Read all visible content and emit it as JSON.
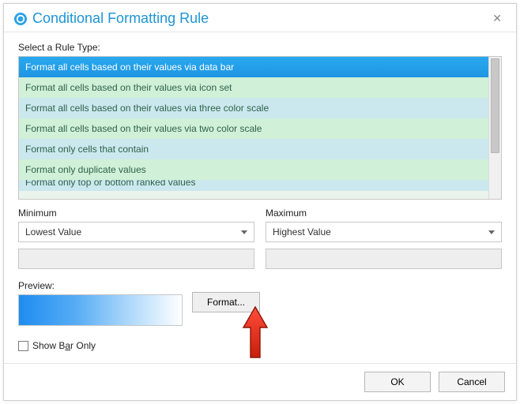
{
  "dialog": {
    "title": "Conditional Formatting Rule",
    "rule_type_label": "Select a Rule Type:",
    "rule_types": [
      "Format all cells based on their values via data bar",
      "Format all cells based on their values via icon set",
      "Format all cells based on their values via three color scale",
      "Format all cells based on their values via two color scale",
      "Format only cells that contain",
      "Format only duplicate values",
      "Format only top or bottom ranked values"
    ],
    "selected_rule_index": 0,
    "minimum": {
      "label": "Minimum",
      "value": "Lowest Value"
    },
    "maximum": {
      "label": "Maximum",
      "value": "Highest Value"
    },
    "preview_label": "Preview:",
    "format_button": "Format...",
    "show_bar_only_prefix": "Show B",
    "show_bar_only_ukey": "a",
    "show_bar_only_suffix": "r Only",
    "show_bar_only_checked": false,
    "ok": "OK",
    "cancel": "Cancel"
  }
}
